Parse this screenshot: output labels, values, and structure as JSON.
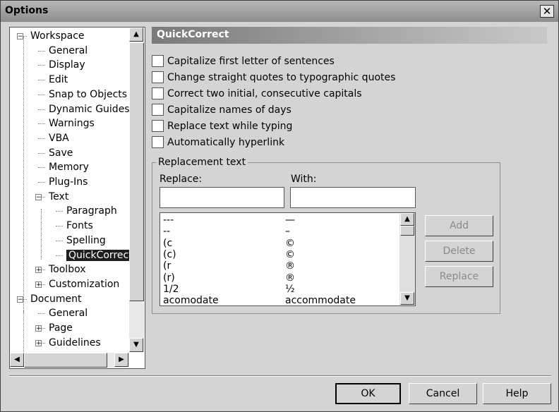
{
  "window": {
    "title": "Options"
  },
  "tree": {
    "items": [
      {
        "label": "Workspace",
        "expander": "−"
      },
      {
        "label": "General"
      },
      {
        "label": "Display"
      },
      {
        "label": "Edit"
      },
      {
        "label": "Snap to Objects"
      },
      {
        "label": "Dynamic Guides"
      },
      {
        "label": "Warnings"
      },
      {
        "label": "VBA"
      },
      {
        "label": "Save"
      },
      {
        "label": "Memory"
      },
      {
        "label": "Plug-Ins"
      },
      {
        "label": "Text",
        "expander": "−"
      },
      {
        "label": "Paragraph"
      },
      {
        "label": "Fonts"
      },
      {
        "label": "Spelling"
      },
      {
        "label": "QuickCorrect",
        "selected": true
      },
      {
        "label": "Toolbox",
        "expander": "+"
      },
      {
        "label": "Customization",
        "expander": "+"
      },
      {
        "label": "Document",
        "expander": "−"
      },
      {
        "label": "General"
      },
      {
        "label": "Page",
        "expander": "+"
      },
      {
        "label": "Guidelines",
        "expander": "+"
      }
    ]
  },
  "panel": {
    "header": "QuickCorrect",
    "options": [
      {
        "label": "Capitalize first letter of sentences",
        "checked": false
      },
      {
        "label": "Change straight quotes to typographic quotes",
        "checked": false
      },
      {
        "label": "Correct two initial, consecutive capitals",
        "checked": false
      },
      {
        "label": "Capitalize names of days",
        "checked": false
      },
      {
        "label": "Replace text while typing",
        "checked": false
      },
      {
        "label": "Automatically hyperlink",
        "checked": false
      }
    ],
    "replacement": {
      "group_title": "Replacement text",
      "replace_label": "Replace:",
      "with_label": "With:",
      "replace_value": "",
      "with_value": "",
      "rows": [
        {
          "from": "---",
          "to": "—"
        },
        {
          "from": "--",
          "to": "–"
        },
        {
          "from": "(c",
          "to": "©"
        },
        {
          "from": "(c)",
          "to": "©"
        },
        {
          "from": "(r",
          "to": "®"
        },
        {
          "from": "(r)",
          "to": "®"
        },
        {
          "from": "1/2",
          "to": "½"
        },
        {
          "from": "acomodate",
          "to": "accommodate"
        }
      ],
      "buttons": {
        "add": "Add",
        "delete": "Delete",
        "replace": "Replace"
      }
    }
  },
  "footer": {
    "ok": "OK",
    "cancel": "Cancel",
    "help": "Help"
  }
}
